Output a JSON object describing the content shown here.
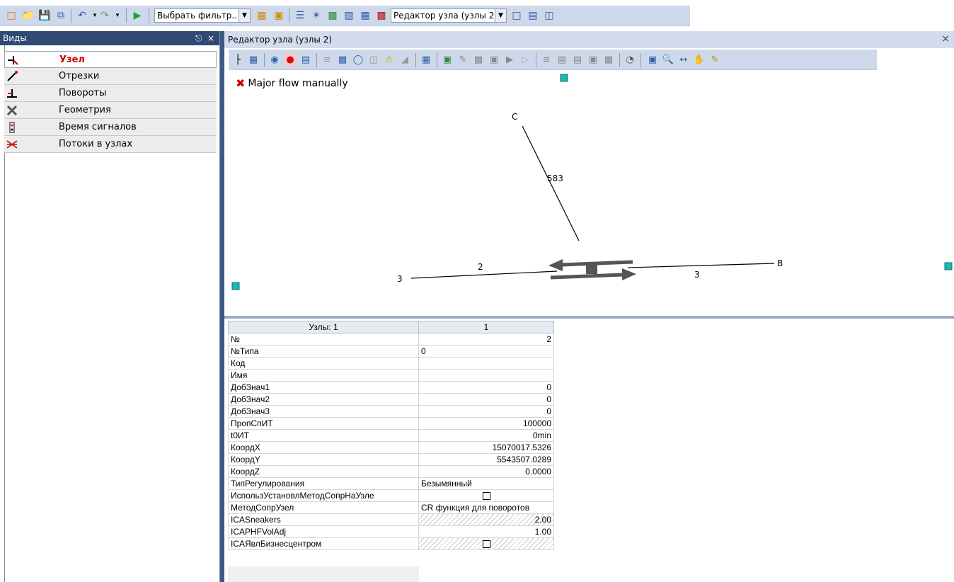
{
  "toolbar": {
    "filter_combo": "Выбрать фильтр..",
    "node_editor_combo": "Редактор узла (узлы 2)"
  },
  "views": {
    "title": "Виды",
    "pin": "ꟷ",
    "close": "×",
    "items": [
      {
        "label": "Узел",
        "icon": "node-icon",
        "active": true
      },
      {
        "label": "Отрезки",
        "icon": "link-icon",
        "active": false
      },
      {
        "label": "Повороты",
        "icon": "turn-icon",
        "active": false
      },
      {
        "label": "Геометрия",
        "icon": "geometry-icon",
        "active": false
      },
      {
        "label": "Время сигналов",
        "icon": "signal-time-icon",
        "active": false
      },
      {
        "label": "Потоки в узлах",
        "icon": "node-flow-icon",
        "active": false
      }
    ]
  },
  "editor": {
    "title": "Редактор узла (узлы 2)",
    "close": "×",
    "major_flow": "Major flow manually",
    "canvas_labels": {
      "node_c": "C",
      "volume_c": "583",
      "left_3": "3",
      "left_2": "2",
      "right_3": "3",
      "node_b": "B"
    }
  },
  "grid": {
    "header_key": "Узлы: 1",
    "header_value": "1",
    "rows": [
      {
        "key": "№",
        "value": "2",
        "align": "right"
      },
      {
        "key": "№Типа",
        "value": "0",
        "align": "left"
      },
      {
        "key": "Код",
        "value": "",
        "align": "left"
      },
      {
        "key": "Имя",
        "value": "",
        "align": "left"
      },
      {
        "key": "ДобЗнач1",
        "value": "0",
        "align": "right"
      },
      {
        "key": "ДобЗнач2",
        "value": "0",
        "align": "right"
      },
      {
        "key": "ДобЗнач3",
        "value": "0",
        "align": "right"
      },
      {
        "key": "ПропСпИТ",
        "value": "100000",
        "align": "right"
      },
      {
        "key": "t0ИТ",
        "value": "0min",
        "align": "right"
      },
      {
        "key": "КоордX",
        "value": "15070017.5326",
        "align": "right"
      },
      {
        "key": "КоордY",
        "value": "5543507.0289",
        "align": "right"
      },
      {
        "key": "КоордZ",
        "value": "0.0000",
        "align": "right"
      },
      {
        "key": "ТипРегулирования",
        "value": "Безымянный",
        "align": "left"
      },
      {
        "key": "ИспользУстановлМетодСопрНаУзле",
        "value": "",
        "align": "checkbox"
      },
      {
        "key": "МетодСопрУзел",
        "value": "CR функция для поворотов",
        "align": "left"
      },
      {
        "key": "ICASneakers",
        "value": "2.00",
        "align": "right",
        "hatched": true
      },
      {
        "key": "ICAPHFVolAdj",
        "value": "1.00",
        "align": "right"
      },
      {
        "key": "ICAЯвлБизнесцентром",
        "value": "",
        "align": "checkbox",
        "hatched": true
      }
    ]
  }
}
